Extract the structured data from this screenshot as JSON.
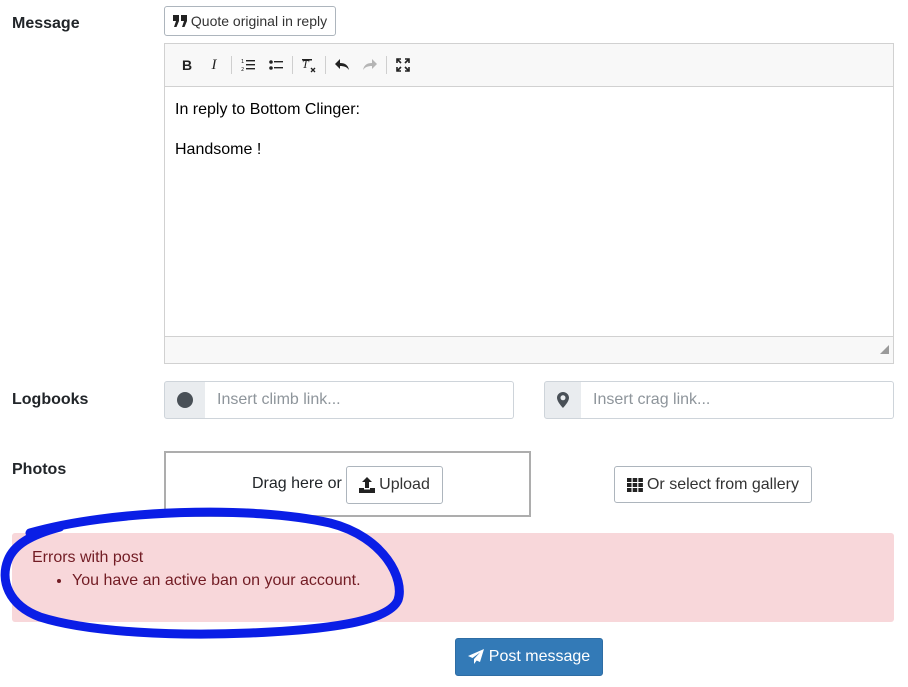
{
  "message": {
    "label": "Message",
    "quote_button": "Quote original in reply",
    "editor_lines": [
      "In reply to Bottom Clinger:",
      "Handsome !"
    ]
  },
  "logbooks": {
    "label": "Logbooks",
    "climb_placeholder": "Insert climb link...",
    "crag_placeholder": "Insert crag link..."
  },
  "photos": {
    "label": "Photos",
    "drag_text": "Drag here or",
    "upload_button": "Upload",
    "gallery_button": "Or select from gallery"
  },
  "alert": {
    "title": "Errors with post",
    "errors": [
      "You have an active ban on your account."
    ],
    "annotation_color": "#0a1ee6"
  },
  "submit": {
    "label": "Post message"
  },
  "colors": {
    "primary": "#337ab7",
    "alert_bg": "#f8d7da",
    "alert_text": "#721c24"
  }
}
